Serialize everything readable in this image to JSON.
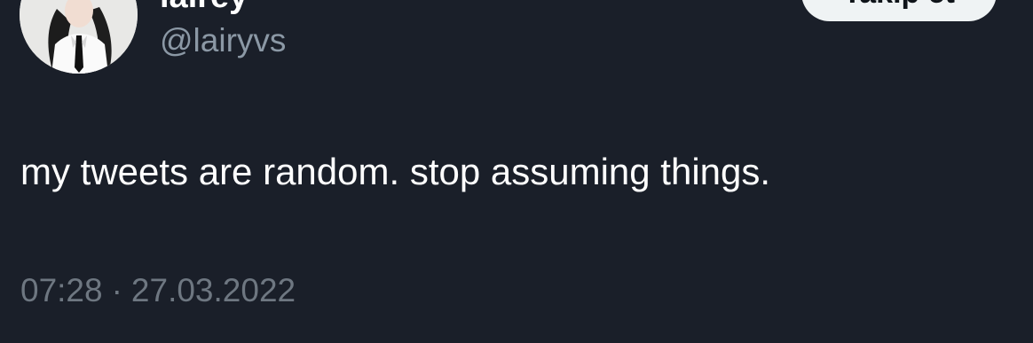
{
  "profile": {
    "display_name": "lairey",
    "handle": "@lairyvs",
    "avatar": "user-avatar-photo"
  },
  "header": {
    "follow_label": "Takip et"
  },
  "tweet": {
    "text": "my tweets are random. stop assuming things.",
    "time": "07:28",
    "separator": "·",
    "date": "27.03.2022"
  },
  "colors": {
    "background": "#1a1f29",
    "text": "#ffffff",
    "secondary_text": "#8b98a5",
    "meta_text": "#6e7781",
    "button_background": "#eff3f4",
    "button_text": "#0f1419"
  }
}
